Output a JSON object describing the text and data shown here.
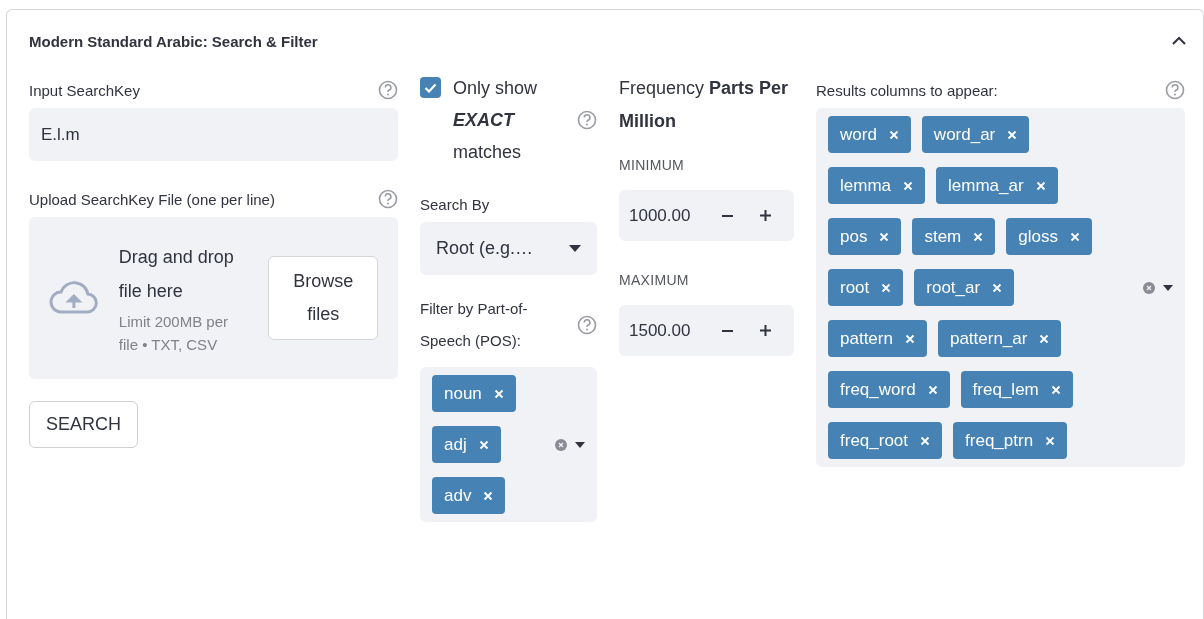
{
  "panel": {
    "title": "Modern Standard Arabic: Search & Filter",
    "expanded": true
  },
  "search_key": {
    "label": "Input SearchKey",
    "value": "E.l.m"
  },
  "upload": {
    "label": "Upload SearchKey File (one per line)",
    "drop_text": "Drag and drop file here",
    "limit_text": "Limit 200MB per file • TXT, CSV",
    "browse_button": "Browse files"
  },
  "exact_only": {
    "label": "Only show **EXACT** matches",
    "checked": true
  },
  "search_by": {
    "label": "Search By",
    "value": "Root (e.g.…"
  },
  "pos_filter": {
    "label": "Filter by Part-of-Speech (POS):",
    "tags": [
      "noun",
      "adj",
      "adv"
    ]
  },
  "frequency": {
    "label": "Frequency **Parts Per Million**",
    "minimum": {
      "label": "MINIMUM",
      "value": "1000.00"
    },
    "maximum": {
      "label": "MAXIMUM",
      "value": "1500.00"
    }
  },
  "result_columns": {
    "label": "Results columns to appear:",
    "tags": [
      "word",
      "word_ar",
      "lemma",
      "lemma_ar",
      "pos",
      "stem",
      "gloss",
      "root",
      "root_ar",
      "pattern",
      "pattern_ar",
      "freq_word",
      "freq_lem",
      "freq_root",
      "freq_ptrn"
    ]
  },
  "search_button": "SEARCH"
}
